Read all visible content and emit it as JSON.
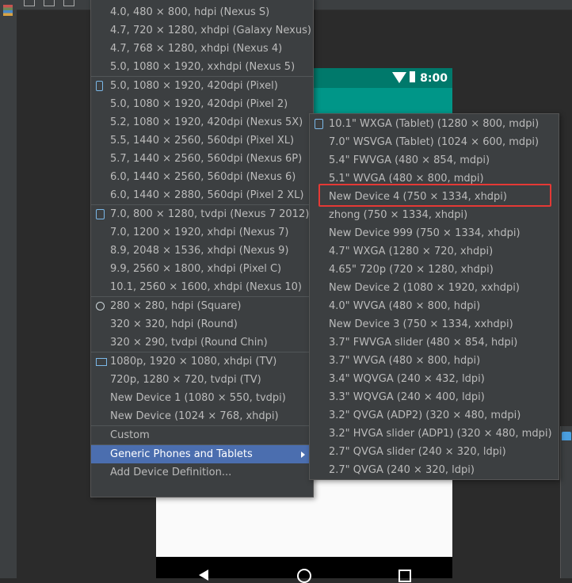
{
  "status_bar": {
    "time": "8:00"
  },
  "device_menu": {
    "groups": [
      {
        "icon": null,
        "items": [
          "4.0, 480 × 800, hdpi (Nexus S)",
          "4.7, 720 × 1280, xhdpi (Galaxy Nexus)",
          "4.7, 768 × 1280, xhdpi (Nexus 4)",
          "5.0, 1080 × 1920, xxhdpi (Nexus 5)"
        ]
      },
      {
        "icon": "phone-icon",
        "items": [
          "5.0, 1080 × 1920, 420dpi (Pixel)",
          "5.0, 1080 × 1920, 420dpi (Pixel 2)",
          "5.2, 1080 × 1920, 420dpi (Nexus 5X)",
          "5.5, 1440 × 2560, 560dpi (Pixel XL)",
          "5.7, 1440 × 2560, 560dpi (Nexus 6P)",
          "6.0, 1440 × 2560, 560dpi (Nexus 6)",
          "6.0, 1440 × 2880, 560dpi (Pixel 2 XL)"
        ]
      },
      {
        "icon": "tablet-icon",
        "items": [
          "7.0, 800 × 1280, tvdpi (Nexus 7 2012)",
          "7.0, 1200 × 1920, xhdpi (Nexus 7)",
          "8.9, 2048 × 1536, xhdpi (Nexus 9)",
          "9.9, 2560 × 1800, xhdpi (Pixel C)",
          "10.1, 2560 × 1600, xhdpi (Nexus 10)"
        ]
      },
      {
        "icon": "watch-icon",
        "items": [
          "280 × 280, hdpi (Square)",
          "320 × 320, hdpi (Round)",
          "320 × 290, tvdpi (Round Chin)"
        ]
      },
      {
        "icon": "tv-icon",
        "items": [
          "1080p, 1920 × 1080, xhdpi (TV)",
          "720p, 1280 × 720, tvdpi (TV)",
          "New Device 1 (1080 × 550, tvdpi)",
          "New Device (1024 × 768, xhdpi)"
        ]
      }
    ],
    "custom": "Custom",
    "generic": "Generic Phones and Tablets",
    "add_definition": "Add Device Definition..."
  },
  "generic_submenu": {
    "icon": "tablet-icon",
    "items": [
      "10.1\" WXGA (Tablet) (1280 × 800, mdpi)",
      "7.0\" WSVGA (Tablet) (1024 × 600, mdpi)",
      "5.4\" FWVGA (480 × 854, mdpi)",
      "5.1\" WVGA (480 × 800, mdpi)",
      "New Device 4 (750 × 1334, xhdpi)",
      "zhong (750 × 1334, xhdpi)",
      "New Device 999 (750 × 1334, xhdpi)",
      "4.7\" WXGA (1280 × 720, xhdpi)",
      "4.65\" 720p (720 × 1280, xhdpi)",
      "New Device 2 (1080 × 1920, xxhdpi)",
      "4.0\" WVGA (480 × 800, hdpi)",
      "New Device 3 (750 × 1334, xxhdpi)",
      "3.7\" FWVGA slider (480 × 854, hdpi)",
      "3.7\" WVGA (480 × 800, hdpi)",
      "3.4\" WQVGA (240 × 432, ldpi)",
      "3.3\" WQVGA (240 × 400, ldpi)",
      "3.2\" QVGA (ADP2) (320 × 480, mdpi)",
      "3.2\" HVGA slider (ADP1) (320 × 480, mdpi)",
      "2.7\" QVGA slider (240 × 320, ldpi)",
      "2.7\" QVGA (240 × 320, ldpi)"
    ],
    "highlighted_item": "New Device 4 (750 × 1334, xhdpi)"
  },
  "colors": {
    "menu_bg": "#3c3f41",
    "selection": "#4b6eaf",
    "status_bar": "#00796b",
    "app_bar": "#009688",
    "highlight_box": "#e53935"
  }
}
